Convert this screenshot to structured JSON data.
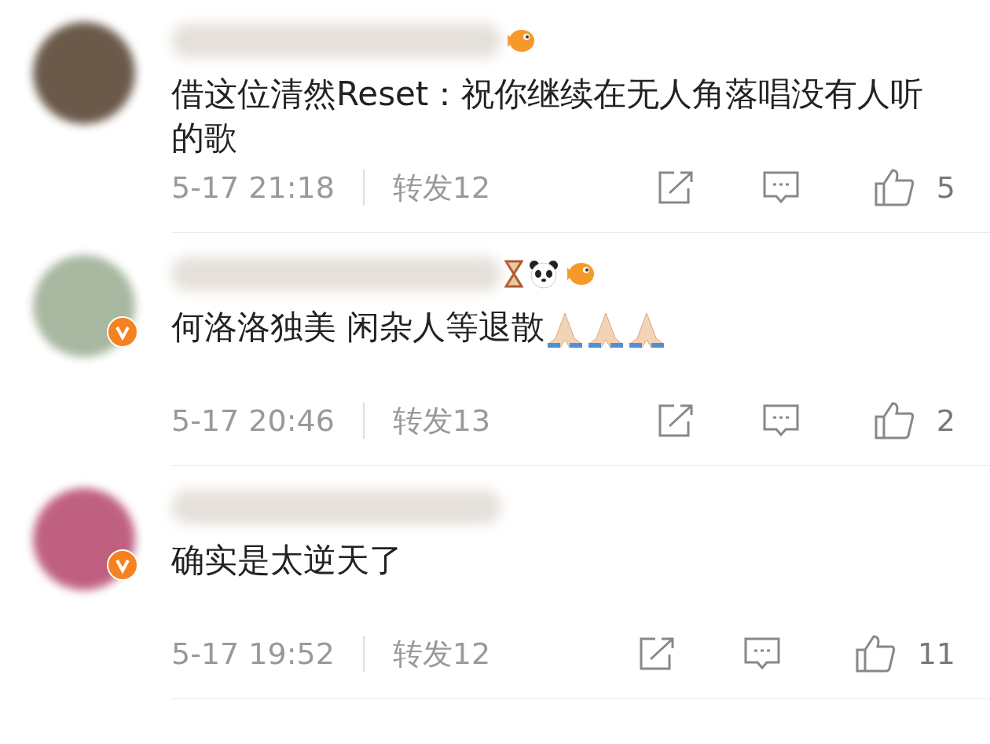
{
  "comments": [
    {
      "verified": false,
      "badges": [
        {
          "kind": "fish"
        }
      ],
      "text": "借这位清然Reset：祝你继续在无人角落唱没有人听的歌",
      "time": "5-17 21:18",
      "repost": "转发12",
      "likes": "5"
    },
    {
      "verified": true,
      "badges": [
        {
          "kind": "hourglass"
        },
        {
          "kind": "panda"
        },
        {
          "kind": "fish"
        }
      ],
      "text": "何洛洛独美 闲杂人等退散",
      "emoji": [
        {
          "kind": "pray"
        },
        {
          "kind": "pray"
        },
        {
          "kind": "pray"
        }
      ],
      "time": "5-17 20:46",
      "repost": "转发13",
      "likes": "2"
    },
    {
      "verified": true,
      "text": "确实是太逆天了",
      "time": "5-17 19:52",
      "repost": "转发12",
      "likes": "11"
    }
  ]
}
